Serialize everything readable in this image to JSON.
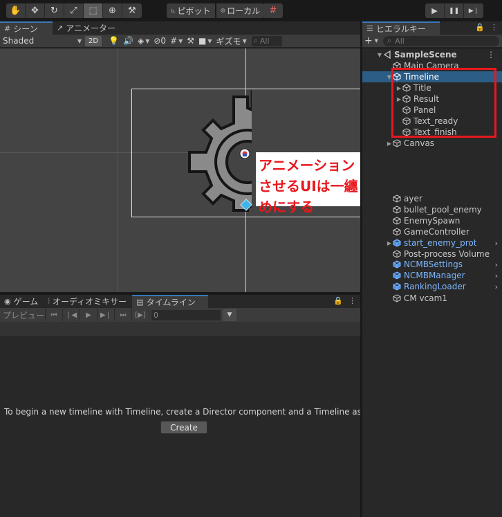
{
  "toolbar": {
    "tools": [
      {
        "name": "hand-tool",
        "glyph": "✋"
      },
      {
        "name": "move-tool",
        "glyph": "✥"
      },
      {
        "name": "rotate-tool",
        "glyph": "↻"
      },
      {
        "name": "scale-tool",
        "glyph": "⤢"
      },
      {
        "name": "rect-tool",
        "glyph": "⬚",
        "active": true
      },
      {
        "name": "transform-tool",
        "glyph": "⊕"
      },
      {
        "name": "custom-tool",
        "glyph": "⚒"
      }
    ],
    "pivot_label": "ピボット",
    "local_label": "ローカル",
    "grid_snap_glyph": "#"
  },
  "playback": {
    "play": "▶",
    "pause": "❚❚",
    "step": "▶❘"
  },
  "scene": {
    "tabs": [
      {
        "label": "シーン",
        "icon": "#",
        "active": true
      },
      {
        "label": "アニメーター",
        "icon": "↗",
        "active": false
      }
    ],
    "shading_mode": "Shaded",
    "mode_2d": "2D",
    "gizmos_label": "ギズモ",
    "hidden_count": "0",
    "search_placeholder": "All"
  },
  "annotation": {
    "callout_text": "アニメーションさせるUIは一纏めにする",
    "highlight_color": "#e8181e"
  },
  "timeline": {
    "tabs": [
      {
        "label": "ゲーム",
        "icon": "◉",
        "active": false
      },
      {
        "label": "オーディオミキサー",
        "icon": "⫶",
        "active": false
      },
      {
        "label": "タイムライン",
        "icon": "▤",
        "active": true
      }
    ],
    "preview_label": "プレビュー",
    "controls": [
      "⏮",
      "❘◀",
      "▶",
      "▶❘",
      "⏭",
      "[▶]"
    ],
    "frame_value": "0",
    "message": "To begin a new timeline with Timeline, create a Director component and a Timeline asset",
    "create_label": "Create"
  },
  "hierarchy": {
    "tab_label": "ヒエラルキー",
    "search_placeholder": "All",
    "items": [
      {
        "label": "SampleScene",
        "depth": 0,
        "arrow": "▼",
        "type": "scene"
      },
      {
        "label": "Main Camera",
        "depth": 1,
        "arrow": "",
        "type": "object"
      },
      {
        "label": "Timeline",
        "depth": 1,
        "arrow": "▼",
        "type": "object",
        "selected": true
      },
      {
        "label": "Title",
        "depth": 2,
        "arrow": "▶",
        "type": "object"
      },
      {
        "label": "Result",
        "depth": 2,
        "arrow": "▶",
        "type": "object"
      },
      {
        "label": "Panel",
        "depth": 2,
        "arrow": "",
        "type": "object"
      },
      {
        "label": "Text_ready",
        "depth": 2,
        "arrow": "",
        "type": "object"
      },
      {
        "label": "Text_finish",
        "depth": 2,
        "arrow": "",
        "type": "object"
      },
      {
        "label": "Canvas",
        "depth": 1,
        "arrow": "▶",
        "type": "object"
      },
      {
        "label": "",
        "depth": 1,
        "arrow": "",
        "type": "hidden"
      },
      {
        "label": "",
        "depth": 1,
        "arrow": "",
        "type": "hidden"
      },
      {
        "label": "ayer",
        "depth": 1,
        "arrow": "",
        "type": "object"
      },
      {
        "label": "bullet_pool_enemy",
        "depth": 1,
        "arrow": "",
        "type": "object"
      },
      {
        "label": "EnemySpawn",
        "depth": 1,
        "arrow": "",
        "type": "object"
      },
      {
        "label": "GameController",
        "depth": 1,
        "arrow": "",
        "type": "object"
      },
      {
        "label": "start_enemy_prot",
        "depth": 1,
        "arrow": "▶",
        "type": "prefab",
        "chevron": true
      },
      {
        "label": "Post-process Volume",
        "depth": 1,
        "arrow": "",
        "type": "object"
      },
      {
        "label": "NCMBSettings",
        "depth": 1,
        "arrow": "",
        "type": "prefab",
        "chevron": true
      },
      {
        "label": "NCMBManager",
        "depth": 1,
        "arrow": "",
        "type": "prefab",
        "chevron": true
      },
      {
        "label": "RankingLoader",
        "depth": 1,
        "arrow": "",
        "type": "prefab",
        "chevron": true
      },
      {
        "label": "CM vcam1",
        "depth": 1,
        "arrow": "",
        "type": "object"
      }
    ]
  }
}
